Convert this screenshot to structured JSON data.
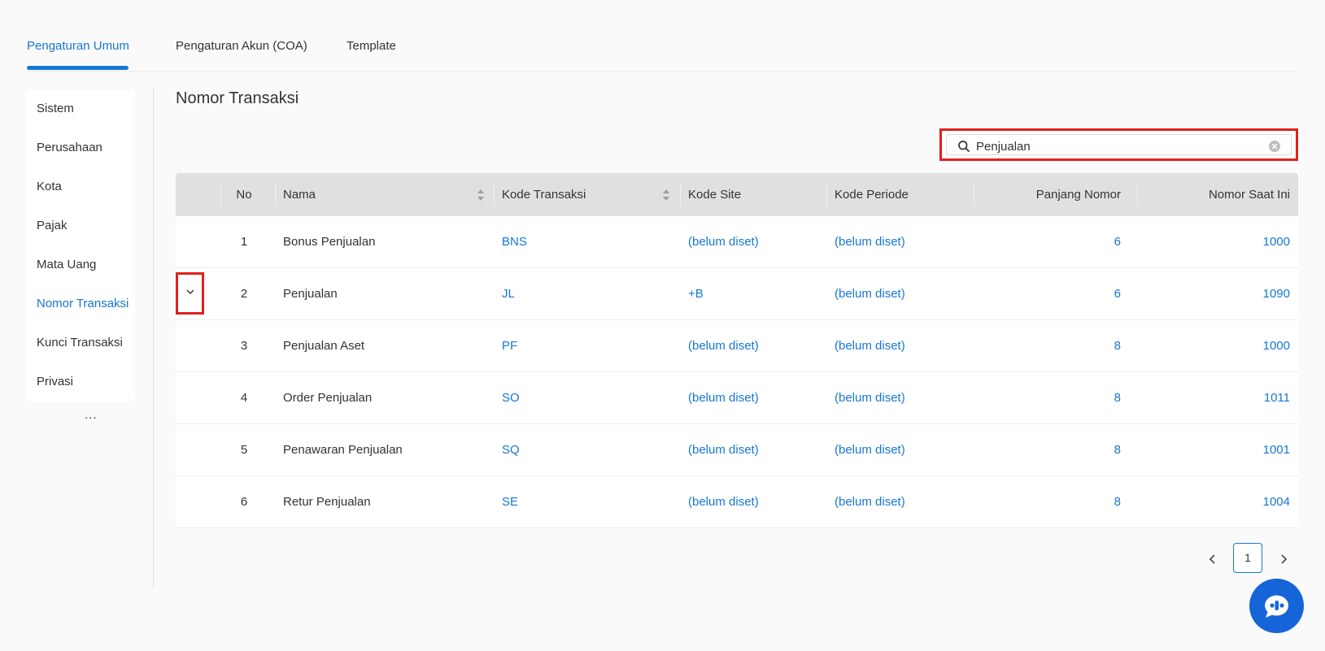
{
  "tabs": [
    {
      "label": "Pengaturan Umum",
      "active": true
    },
    {
      "label": "Pengaturan Akun (COA)",
      "active": false
    },
    {
      "label": "Template",
      "active": false
    }
  ],
  "side_menu": {
    "items": [
      {
        "label": "Sistem"
      },
      {
        "label": "Perusahaan"
      },
      {
        "label": "Kota"
      },
      {
        "label": "Pajak"
      },
      {
        "label": "Mata Uang"
      },
      {
        "label": "Nomor Transaksi",
        "active": true
      },
      {
        "label": "Kunci Transaksi"
      },
      {
        "label": "Privasi"
      }
    ],
    "more": "..."
  },
  "section_title": "Nomor Transaksi",
  "search": {
    "value": "Penjualan",
    "icon": "search-icon",
    "clear_icon": "close-circle-icon"
  },
  "table": {
    "columns": {
      "no": "No",
      "nama": "Nama",
      "kode_transaksi": "Kode Transaksi",
      "kode_site": "Kode Site",
      "kode_periode": "Kode Periode",
      "panjang_nomor": "Panjang Nomor",
      "nomor_saat_ini": "Nomor Saat Ini"
    },
    "rows": [
      {
        "no": "1",
        "nama": "Bonus Penjualan",
        "kode_transaksi": "BNS",
        "kode_site": "(belum diset)",
        "kode_periode": "(belum diset)",
        "panjang_nomor": "6",
        "nomor_saat_ini": "1000"
      },
      {
        "no": "2",
        "nama": "Penjualan",
        "kode_transaksi": "JL",
        "kode_site": "+B",
        "kode_periode": "(belum diset)",
        "panjang_nomor": "6",
        "nomor_saat_ini": "1090",
        "expandable": true
      },
      {
        "no": "3",
        "nama": "Penjualan Aset",
        "kode_transaksi": "PF",
        "kode_site": "(belum diset)",
        "kode_periode": "(belum diset)",
        "panjang_nomor": "8",
        "nomor_saat_ini": "1000"
      },
      {
        "no": "4",
        "nama": "Order Penjualan",
        "kode_transaksi": "SO",
        "kode_site": "(belum diset)",
        "kode_periode": "(belum diset)",
        "panjang_nomor": "8",
        "nomor_saat_ini": "1011"
      },
      {
        "no": "5",
        "nama": "Penawaran Penjualan",
        "kode_transaksi": "SQ",
        "kode_site": "(belum diset)",
        "kode_periode": "(belum diset)",
        "panjang_nomor": "8",
        "nomor_saat_ini": "1001"
      },
      {
        "no": "6",
        "nama": "Retur Penjualan",
        "kode_transaksi": "SE",
        "kode_site": "(belum diset)",
        "kode_periode": "(belum diset)",
        "panjang_nomor": "8",
        "nomor_saat_ini": "1004"
      }
    ]
  },
  "pagination": {
    "current_page": "1"
  },
  "colors": {
    "accent": "#1677d2",
    "highlight": "#e0201c",
    "chat": "#1565d8"
  }
}
